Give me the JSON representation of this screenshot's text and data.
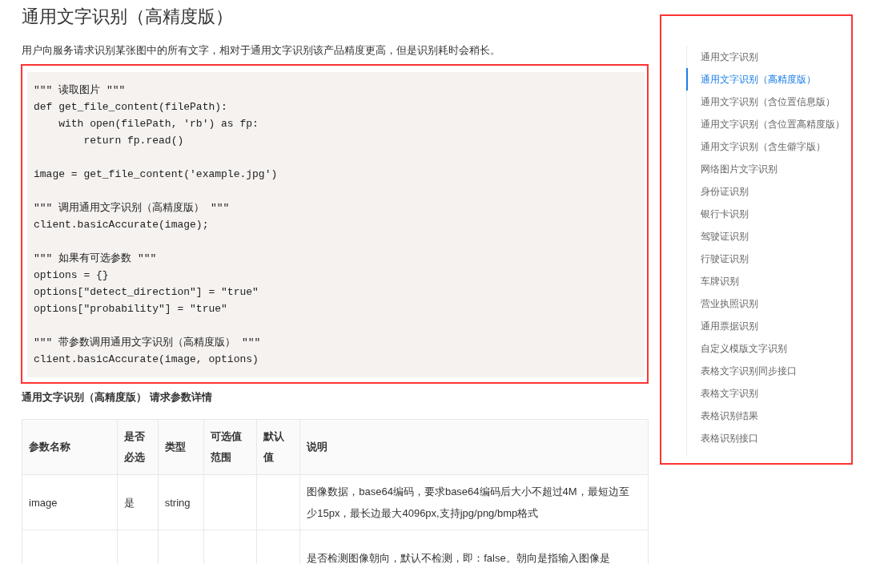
{
  "title": "通用文字识别（高精度版）",
  "description": "用户向服务请求识别某张图中的所有文字，相对于通用文字识别该产品精度更高，但是识别耗时会稍长。",
  "code_blocks": [
    {
      "lines": [
        "\"\"\" 读取图片 \"\"\"",
        "def get_file_content(filePath):",
        "    with open(filePath, 'rb') as fp:",
        "        return fp.read()"
      ]
    },
    {
      "lines": [
        "image = get_file_content('example.jpg')"
      ]
    },
    {
      "lines": [
        "\"\"\" 调用通用文字识别（高精度版） \"\"\"",
        "client.basicAccurate(image);"
      ]
    },
    {
      "lines": [
        "\"\"\" 如果有可选参数 \"\"\"",
        "options = {}",
        "options[\"detect_direction\"] = \"true\"",
        "options[\"probability\"] = \"true\""
      ]
    },
    {
      "lines": [
        "\"\"\" 带参数调用通用文字识别（高精度版） \"\"\"",
        "client.basicAccurate(image, options)"
      ]
    }
  ],
  "params_heading": "通用文字识别（高精度版） 请求参数详情",
  "table": {
    "columns": [
      "参数名称",
      "是否必选",
      "类型",
      "可选值范围",
      "默认值",
      "说明"
    ],
    "rows": [
      [
        "image",
        "是",
        "string",
        "",
        "",
        "图像数据，base64编码，要求base64编码后大小不超过4M，最短边至少15px，最长边最大4096px,支持jpg/png/bmp格式"
      ],
      [
        "",
        "",
        "",
        "",
        "",
        "是否检测图像朝向，默认不检测，即：false。朝向是指输入图像是"
      ]
    ]
  },
  "toc": [
    {
      "label": "通用文字识别",
      "selected": false
    },
    {
      "label": "通用文字识别（高精度版）",
      "selected": true
    },
    {
      "label": "通用文字识别（含位置信息版）",
      "selected": false
    },
    {
      "label": "通用文字识别（含位置高精度版）",
      "selected": false
    },
    {
      "label": "通用文字识别（含生僻字版）",
      "selected": false
    },
    {
      "label": "网络图片文字识别",
      "selected": false
    },
    {
      "label": "身份证识别",
      "selected": false
    },
    {
      "label": "银行卡识别",
      "selected": false
    },
    {
      "label": "驾驶证识别",
      "selected": false
    },
    {
      "label": "行驶证识别",
      "selected": false
    },
    {
      "label": "车牌识别",
      "selected": false
    },
    {
      "label": "营业执照识别",
      "selected": false
    },
    {
      "label": "通用票据识别",
      "selected": false
    },
    {
      "label": "自定义模版文字识别",
      "selected": false
    },
    {
      "label": "表格文字识别同步接口",
      "selected": false
    },
    {
      "label": "表格文字识别",
      "selected": false
    },
    {
      "label": "表格识别结果",
      "selected": false
    },
    {
      "label": "表格识别接口",
      "selected": false
    }
  ]
}
